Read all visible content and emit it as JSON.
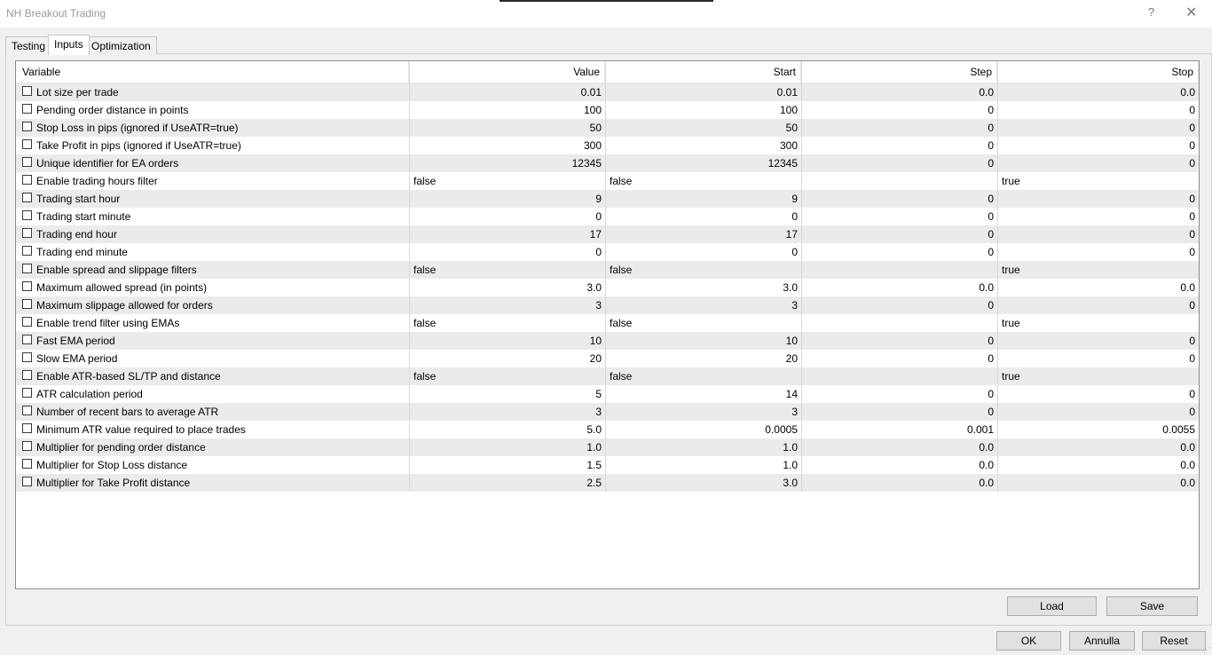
{
  "window": {
    "title": "NH Breakout Trading",
    "help_label": "?",
    "close_label": "✕"
  },
  "tabs": [
    {
      "label": "Testing"
    },
    {
      "label": "Inputs"
    },
    {
      "label": "Optimization"
    }
  ],
  "grid": {
    "headers": {
      "variable": "Variable",
      "value": "Value",
      "start": "Start",
      "step": "Step",
      "stop": "Stop"
    },
    "rows": [
      {
        "name": "Lot size per trade",
        "value": "0.01",
        "start": "0.01",
        "step": "0.0",
        "stop": "0.0"
      },
      {
        "name": "Pending order distance in points",
        "value": "100",
        "start": "100",
        "step": "0",
        "stop": "0"
      },
      {
        "name": "Stop Loss in pips (ignored if UseATR=true)",
        "value": "50",
        "start": "50",
        "step": "0",
        "stop": "0"
      },
      {
        "name": "Take Profit in pips (ignored if UseATR=true)",
        "value": "300",
        "start": "300",
        "step": "0",
        "stop": "0"
      },
      {
        "name": "Unique identifier for EA orders",
        "value": "12345",
        "start": "12345",
        "step": "0",
        "stop": "0"
      },
      {
        "name": "Enable trading hours filter",
        "value": "false",
        "start": "false",
        "step": "",
        "stop": "true"
      },
      {
        "name": "Trading start hour",
        "value": "9",
        "start": "9",
        "step": "0",
        "stop": "0"
      },
      {
        "name": "Trading start minute",
        "value": "0",
        "start": "0",
        "step": "0",
        "stop": "0"
      },
      {
        "name": "Trading end hour",
        "value": "17",
        "start": "17",
        "step": "0",
        "stop": "0"
      },
      {
        "name": "Trading end minute",
        "value": "0",
        "start": "0",
        "step": "0",
        "stop": "0"
      },
      {
        "name": "Enable spread and slippage filters",
        "value": "false",
        "start": "false",
        "step": "",
        "stop": "true"
      },
      {
        "name": "Maximum allowed spread (in points)",
        "value": "3.0",
        "start": "3.0",
        "step": "0.0",
        "stop": "0.0"
      },
      {
        "name": "Maximum slippage allowed for orders",
        "value": "3",
        "start": "3",
        "step": "0",
        "stop": "0"
      },
      {
        "name": "Enable trend filter using EMAs",
        "value": "false",
        "start": "false",
        "step": "",
        "stop": "true"
      },
      {
        "name": "Fast EMA period",
        "value": "10",
        "start": "10",
        "step": "0",
        "stop": "0"
      },
      {
        "name": "Slow EMA period",
        "value": "20",
        "start": "20",
        "step": "0",
        "stop": "0"
      },
      {
        "name": "Enable ATR-based SL/TP and distance",
        "value": "false",
        "start": "false",
        "step": "",
        "stop": "true"
      },
      {
        "name": "ATR calculation period",
        "value": "5",
        "start": "14",
        "step": "0",
        "stop": "0"
      },
      {
        "name": "Number of recent bars to average ATR",
        "value": "3",
        "start": "3",
        "step": "0",
        "stop": "0"
      },
      {
        "name": "Minimum ATR value required to place trades",
        "value": "5.0",
        "start": "0.0005",
        "step": "0.001",
        "stop": "0.0055"
      },
      {
        "name": "Multiplier for pending order distance",
        "value": "1.0",
        "start": "1.0",
        "step": "0.0",
        "stop": "0.0"
      },
      {
        "name": "Multiplier for Stop Loss distance",
        "value": "1.5",
        "start": "1.0",
        "step": "0.0",
        "stop": "0.0"
      },
      {
        "name": "Multiplier for Take Profit distance",
        "value": "2.5",
        "start": "3.0",
        "step": "0.0",
        "stop": "0.0"
      }
    ]
  },
  "buttons": {
    "load": "Load",
    "save": "Save",
    "ok": "OK",
    "annulla": "Annulla",
    "reset": "Reset"
  },
  "colors": {
    "row_shade": "#ebebeb",
    "button_bg": "#e1e1e1"
  }
}
